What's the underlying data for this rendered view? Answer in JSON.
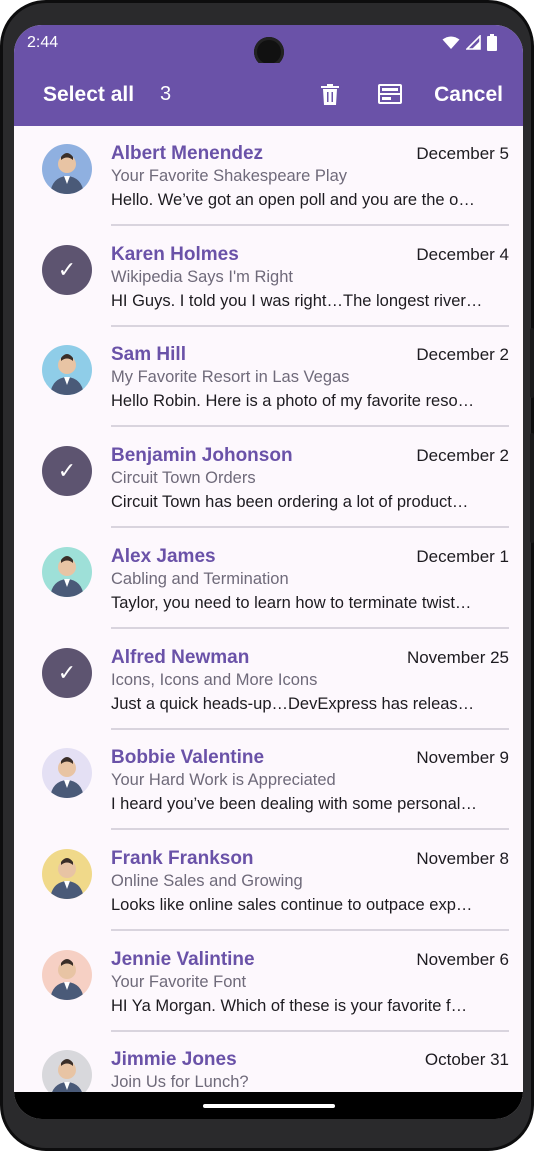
{
  "status_bar": {
    "time": "2:44",
    "icons": [
      "wifi-icon",
      "signal-icon",
      "battery-icon"
    ]
  },
  "app_bar": {
    "select_all_label": "Select all",
    "selected_count": "3",
    "delete_icon": "trash-icon",
    "archive_icon": "archive-icon",
    "cancel_label": "Cancel"
  },
  "colors": {
    "accent": "#6a52a8",
    "selected_check": "#5d5470",
    "background": "#fdf8fd"
  },
  "emails": [
    {
      "name": "Albert Menendez",
      "date": "December 5",
      "subject": "Your Favorite Shakespeare Play",
      "preview": "Hello. We’ve got an open poll and you are the o…",
      "selected": false,
      "avatar_bg": "#8fb0e0"
    },
    {
      "name": "Karen Holmes",
      "date": "December 4",
      "subject": "Wikipedia Says I'm Right",
      "preview": "HI Guys. I told you I was right…The longest river…",
      "selected": true,
      "avatar_bg": "#c9a890"
    },
    {
      "name": "Sam Hill",
      "date": "December 2",
      "subject": "My Favorite Resort in Las Vegas",
      "preview": "Hello Robin. Here is a photo of my favorite reso…",
      "selected": false,
      "avatar_bg": "#8fcde8"
    },
    {
      "name": "Benjamin Johonson",
      "date": "December 2",
      "subject": "Circuit Town Orders",
      "preview": "Circuit Town has been ordering a lot of product…",
      "selected": true,
      "avatar_bg": "#b0b8c8"
    },
    {
      "name": "Alex James",
      "date": "December 1",
      "subject": "Cabling and Termination",
      "preview": "Taylor, you need to learn how to terminate twist…",
      "selected": false,
      "avatar_bg": "#9ee0d8"
    },
    {
      "name": "Alfred Newman",
      "date": "November 25",
      "subject": "Icons, Icons and More Icons",
      "preview": "Just a quick heads-up…DevExpress has release…",
      "selected": true,
      "avatar_bg": "#c8b090"
    },
    {
      "name": "Bobbie Valentine",
      "date": "November 9",
      "subject": "Your Hard Work is Appreciated",
      "preview": "I heard you’ve been dealing with some personal…",
      "selected": false,
      "avatar_bg": "#e4e0f4"
    },
    {
      "name": "Frank Frankson",
      "date": "November 8",
      "subject": "Online Sales and Growing",
      "preview": "Looks like online sales continue to outpace exp…",
      "selected": false,
      "avatar_bg": "#f0d98a"
    },
    {
      "name": "Jennie Valintine",
      "date": "November 6",
      "subject": "Your Favorite Font",
      "preview": "HI Ya Morgan. Which of these is your favorite f…",
      "selected": false,
      "avatar_bg": "#f6d0c4"
    },
    {
      "name": "Jimmie Jones",
      "date": "October 31",
      "subject": "Join Us for Lunch?",
      "preview": "",
      "selected": false,
      "avatar_bg": "#d8d8dc"
    }
  ]
}
